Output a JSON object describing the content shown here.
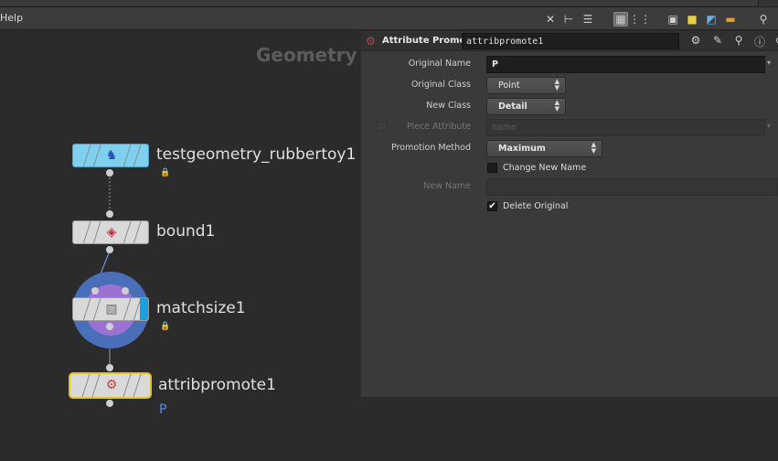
{
  "menubar": {
    "help_label": "Help"
  },
  "toolbar": {
    "icons": [
      "tools-icon",
      "tree-icon",
      "list-icon",
      "grid-view-icon",
      "grid-alt-icon",
      "display-options-icon",
      "sticky-note-icon",
      "image-icon",
      "network-box-icon",
      "search-icon"
    ]
  },
  "network": {
    "context_label": "Geometry",
    "nodes": [
      {
        "name": "testgeometry_rubbertoy1",
        "locked": true
      },
      {
        "name": "bound1",
        "locked": false
      },
      {
        "name": "matchsize1",
        "locked": true
      },
      {
        "name": "attribpromote1",
        "locked": false,
        "selected": true,
        "comment": "P"
      }
    ]
  },
  "params": {
    "node_type": "Attribute Promote",
    "node_name": "attribpromote1",
    "fields": {
      "original_name_label": "Original Name",
      "original_name_value": "P",
      "original_class_label": "Original Class",
      "original_class_value": "Point",
      "new_class_label": "New Class",
      "new_class_value": "Detail",
      "piece_attribute_label": "Piece Attribute",
      "piece_attribute_placeholder": "name",
      "promotion_method_label": "Promotion Method",
      "promotion_method_value": "Maximum",
      "change_new_name_label": "Change New Name",
      "new_name_label": "New Name",
      "delete_original_label": "Delete Original"
    },
    "checkboxes": {
      "change_new_name": false,
      "delete_original": true,
      "piece_attribute_enabled": false
    }
  },
  "colors": {
    "selected_outline": "#e6c220",
    "match_ring": "#4a6fb8",
    "match_inner": "#9b72d1",
    "display_flag": "#18a0e0",
    "rubbertoy_fill": "#7fd0ef",
    "comment_color": "#5b8fe0"
  }
}
